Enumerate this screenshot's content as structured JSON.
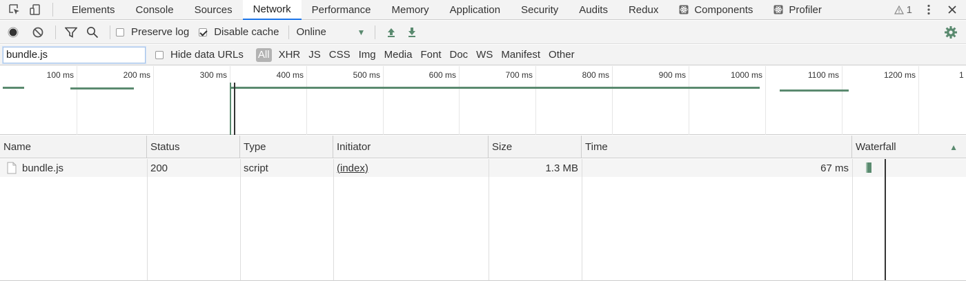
{
  "tabs": {
    "items": [
      {
        "label": "Elements"
      },
      {
        "label": "Console"
      },
      {
        "label": "Sources"
      },
      {
        "label": "Network",
        "active": true
      },
      {
        "label": "Performance"
      },
      {
        "label": "Memory"
      },
      {
        "label": "Application"
      },
      {
        "label": "Security"
      },
      {
        "label": "Audits"
      },
      {
        "label": "Redux"
      },
      {
        "label": "Components",
        "icon": "react-icon"
      },
      {
        "label": "Profiler",
        "icon": "react-icon"
      }
    ],
    "warnings_count": "1"
  },
  "toolbar": {
    "preserve_log_label": "Preserve log",
    "preserve_log_checked": false,
    "disable_cache_label": "Disable cache",
    "disable_cache_checked": true,
    "throttling_value": "Online"
  },
  "filter": {
    "input_value": "bundle.js",
    "hide_data_urls_label": "Hide data URLs",
    "types": [
      "All",
      "XHR",
      "JS",
      "CSS",
      "Img",
      "Media",
      "Font",
      "Doc",
      "WS",
      "Manifest",
      "Other"
    ],
    "active_type": "All"
  },
  "overview": {
    "ticks": [
      "100 ms",
      "200 ms",
      "300 ms",
      "400 ms",
      "500 ms",
      "600 ms",
      "700 ms",
      "800 ms",
      "900 ms",
      "1000 ms",
      "1100 ms",
      "1200 ms",
      "1"
    ]
  },
  "table": {
    "columns": [
      "Name",
      "Status",
      "Type",
      "Initiator",
      "Size",
      "Time",
      "Waterfall"
    ],
    "sort_indicator": "▲",
    "rows": [
      {
        "name": "bundle.js",
        "status": "200",
        "type": "script",
        "initiator": "(index)",
        "size": "1.3 MB",
        "time": "67 ms"
      }
    ]
  },
  "colors": {
    "accent_green": "#5a8a6f",
    "tab_active_underline": "#1a73e8",
    "record_dot": "#333333"
  }
}
